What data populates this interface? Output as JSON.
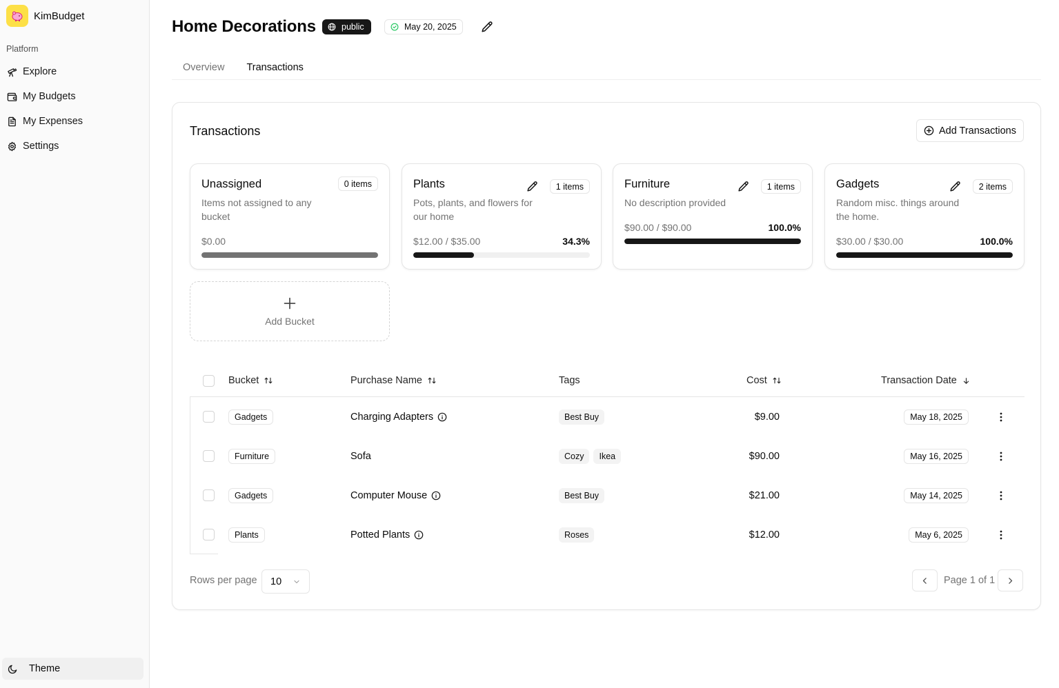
{
  "sidebar": {
    "brand": "KimBudget",
    "section_label": "Platform",
    "items": [
      {
        "label": "Explore",
        "icon": "telescope-icon"
      },
      {
        "label": "My Budgets",
        "icon": "wallet-icon"
      },
      {
        "label": "My Expenses",
        "icon": "receipt-icon"
      },
      {
        "label": "Settings",
        "icon": "gear-icon"
      }
    ],
    "theme_label": "Theme"
  },
  "header": {
    "title": "Home Decorations",
    "visibility": "public",
    "date": "May 20, 2025"
  },
  "tabs": [
    {
      "label": "Overview",
      "active": false
    },
    {
      "label": "Transactions",
      "active": true
    }
  ],
  "transactions": {
    "title": "Transactions",
    "add_button": "Add Transactions",
    "add_bucket": "Add Bucket",
    "buckets": [
      {
        "name": "Unassigned",
        "description": "Items not assigned to any bucket",
        "count": "0 items",
        "amount": "$0.00",
        "percent": "",
        "fill": 1.0
      },
      {
        "name": "Plants",
        "description": "Pots, plants, and flowers for our home",
        "count": "1 items",
        "amount": "$12.00 / $35.00",
        "percent": "34.3%",
        "fill": 0.343
      },
      {
        "name": "Furniture",
        "description": "No description provided",
        "count": "1 items",
        "amount": "$90.00 / $90.00",
        "percent": "100.0%",
        "fill": 1.0
      },
      {
        "name": "Gadgets",
        "description": "Random misc. things around the home.",
        "count": "2 items",
        "amount": "$30.00 / $30.00",
        "percent": "100.0%",
        "fill": 1.0
      }
    ],
    "columns": {
      "bucket": "Bucket",
      "purchase": "Purchase Name",
      "tags": "Tags",
      "cost": "Cost",
      "date": "Transaction Date"
    },
    "rows": [
      {
        "bucket": "Gadgets",
        "purchase": "Charging Adapters",
        "info": true,
        "tags": [
          "Best Buy"
        ],
        "cost": "$9.00",
        "date": "May 18, 2025"
      },
      {
        "bucket": "Furniture",
        "purchase": "Sofa",
        "info": false,
        "tags": [
          "Cozy",
          "Ikea"
        ],
        "cost": "$90.00",
        "date": "May 16, 2025"
      },
      {
        "bucket": "Gadgets",
        "purchase": "Computer Mouse",
        "info": true,
        "tags": [
          "Best Buy"
        ],
        "cost": "$21.00",
        "date": "May 14, 2025"
      },
      {
        "bucket": "Plants",
        "purchase": "Potted Plants",
        "info": true,
        "tags": [
          "Roses"
        ],
        "cost": "$12.00",
        "date": "May 6, 2025"
      }
    ],
    "pagination": {
      "rows_per_page_label": "Rows per page",
      "rows_per_page": "10",
      "page_text": "Page 1 of 1"
    }
  }
}
